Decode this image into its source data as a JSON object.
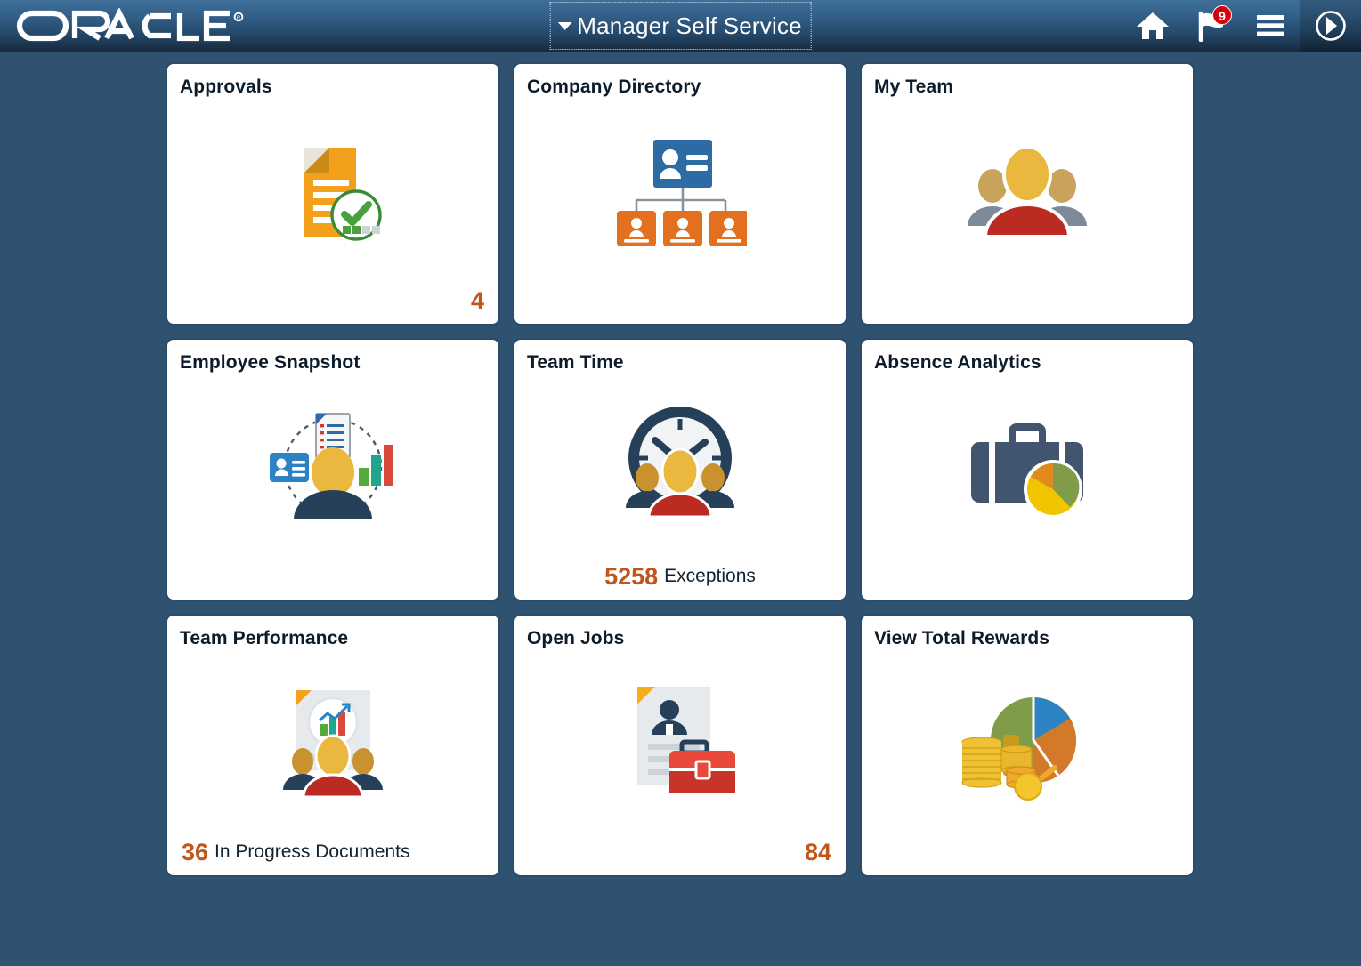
{
  "header": {
    "logo_text": "ORACLE",
    "logo_trademark": "®",
    "title": "Manager Self Service",
    "caret_icon": "caret-down-icon",
    "actions": [
      {
        "name": "home",
        "icon": "home-icon",
        "label": "Home"
      },
      {
        "name": "notifications",
        "icon": "flag-icon",
        "label": "Notifications",
        "badge": "9"
      },
      {
        "name": "actions-list",
        "icon": "hamburger-menu-icon",
        "label": "Actions List"
      },
      {
        "name": "navigator",
        "icon": "compass-navigator-icon",
        "label": "Navigator"
      }
    ],
    "colors": {
      "header_top": "#3E7099",
      "header_bottom": "#18293D",
      "badge_red": "#D7000F",
      "page_background": "#2F5270"
    }
  },
  "tiles": [
    {
      "title": "Approvals",
      "icon": "approvals-document-check-icon",
      "footer": {
        "count": "4",
        "label": "",
        "align": "right"
      }
    },
    {
      "title": "Company Directory",
      "icon": "org-chart-icon",
      "footer": {
        "count": "",
        "label": "",
        "align": "none"
      }
    },
    {
      "title": "My Team",
      "icon": "people-group-icon",
      "footer": {
        "count": "",
        "label": "",
        "align": "none"
      }
    },
    {
      "title": "Employee Snapshot",
      "icon": "employee-snapshot-icon",
      "footer": {
        "count": "",
        "label": "",
        "align": "none"
      }
    },
    {
      "title": "Team Time",
      "icon": "clock-people-icon",
      "footer": {
        "count": "5258",
        "label": "Exceptions",
        "align": "center"
      }
    },
    {
      "title": "Absence Analytics",
      "icon": "briefcase-pie-chart-icon",
      "footer": {
        "count": "",
        "label": "",
        "align": "none"
      }
    },
    {
      "title": "Team Performance",
      "icon": "performance-document-people-icon",
      "footer": {
        "count": "36",
        "label": "In Progress Documents",
        "align": "left"
      }
    },
    {
      "title": "Open Jobs",
      "icon": "resume-briefcase-icon",
      "footer": {
        "count": "84",
        "label": "",
        "align": "right"
      }
    },
    {
      "title": "View Total Rewards",
      "icon": "pie-chart-coins-icon",
      "footer": {
        "count": "",
        "label": "",
        "align": "none"
      }
    }
  ],
  "colors": {
    "tile_border": "#2B4C68",
    "tile_background": "#FFFFFF",
    "count_orange": "#C0561A",
    "title_text": "#0D1C2B"
  }
}
